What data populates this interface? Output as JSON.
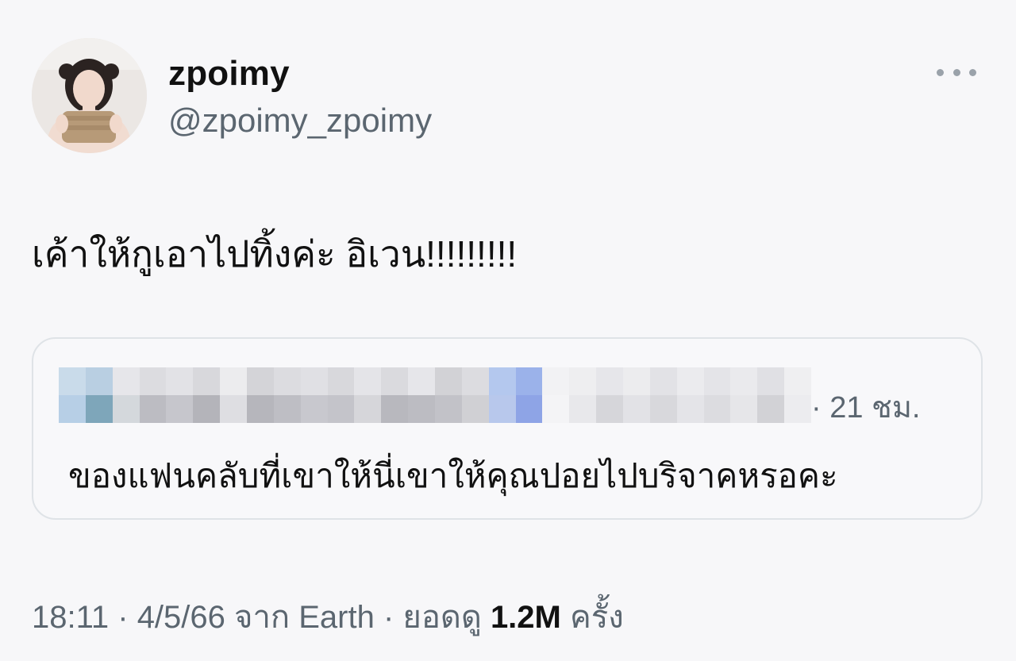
{
  "tweet": {
    "author": {
      "display_name": "zpoimy",
      "handle": "@zpoimy_zpoimy"
    },
    "text": "เค้าให้กูเอาไปทิ้งค่ะ อิเวน!!!!!!!!!"
  },
  "quote": {
    "time": "· 21 ชม.",
    "text": "ของแฟนคลับที่เขาให้นี่เขาให้คุณปอยไปบริจาคหรอคะ"
  },
  "meta": {
    "time": "18:11",
    "sep1": " · ",
    "date": "4/5/66",
    "source_prefix": " จาก ",
    "source": "Earth",
    "sep2": " · ",
    "views_label": "ยอดดู ",
    "views_count": "1.2M",
    "views_suffix": " ครั้ง"
  },
  "icons": {
    "more": "more-horizontal-icon"
  },
  "colors": {
    "text_primary": "#111111",
    "text_secondary": "#5b6670",
    "background": "#f7f7f9",
    "card_border": "#dfe3e7"
  }
}
